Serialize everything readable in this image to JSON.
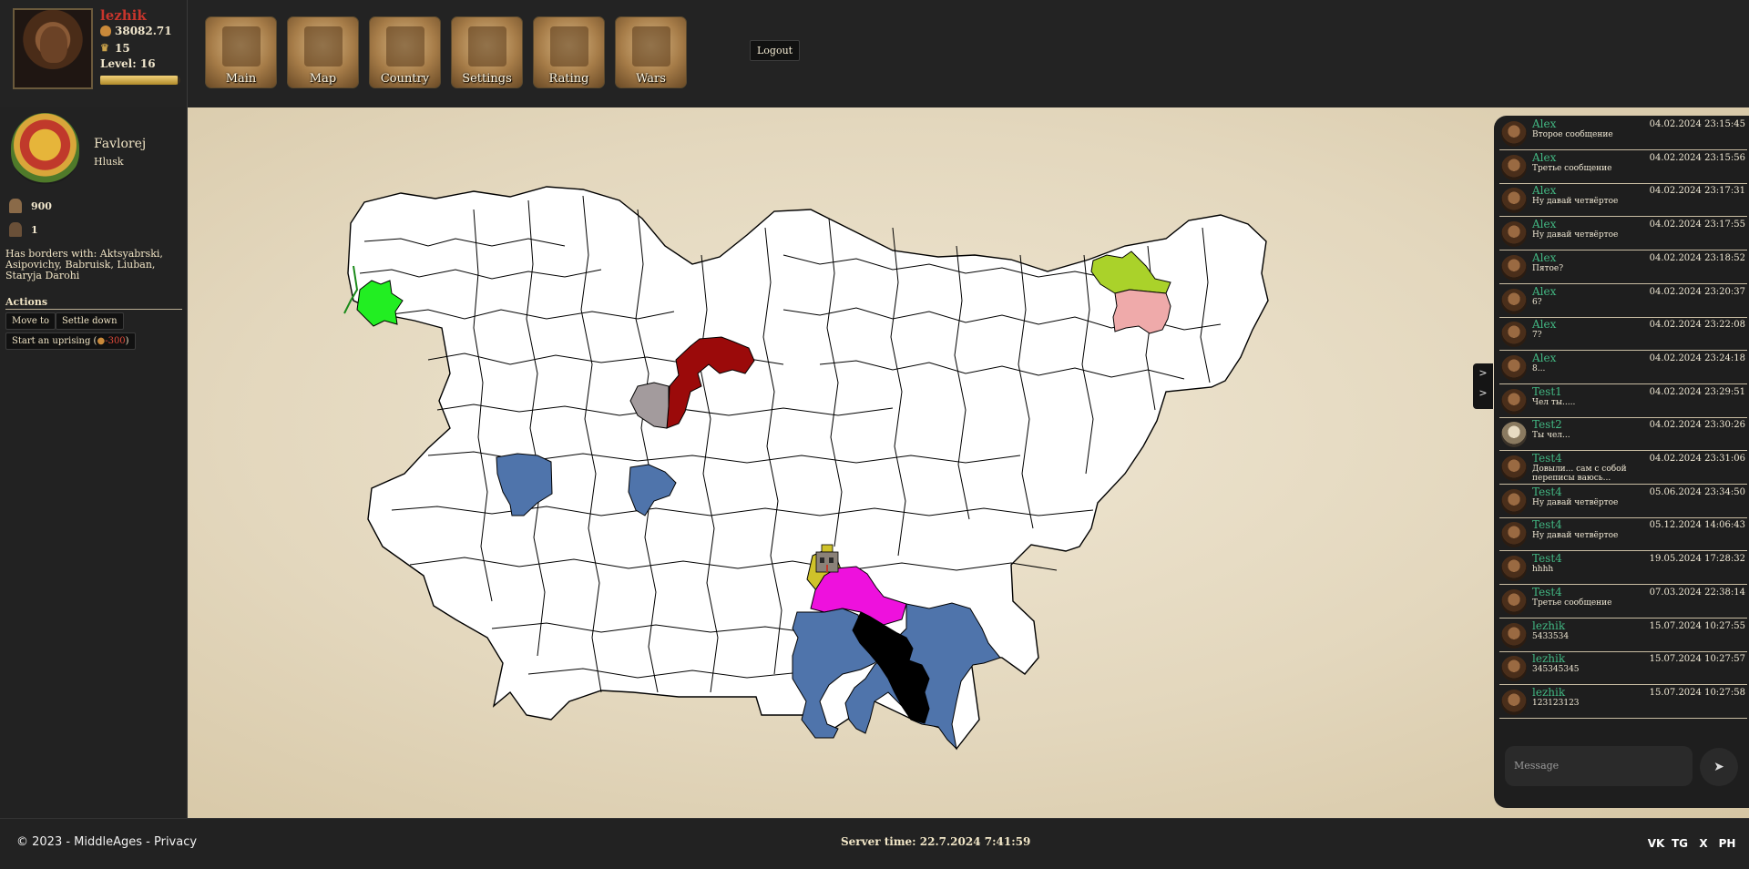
{
  "player": {
    "name": "lezhik",
    "gold": "38082.71",
    "crowns": "15",
    "level": "Level: 16",
    "level_progress": 0.97
  },
  "nav": [
    {
      "label": "Main",
      "icon": "town-icon"
    },
    {
      "label": "Map",
      "icon": "map-icon"
    },
    {
      "label": "Country",
      "icon": "scroll-icon"
    },
    {
      "label": "Settings",
      "icon": "crest-icon"
    },
    {
      "label": "Rating",
      "icon": "knight-icon"
    },
    {
      "label": "Wars",
      "icon": "shield-icon"
    }
  ],
  "logout_label": "Logout",
  "region": {
    "name": "Favlorej",
    "province": "Hlusk",
    "troops": "900",
    "lords": "1",
    "borders_text": "Has borders with: Aktsyabrski, Asipovichy, Babruisk, Liuban, Staryja Darohi",
    "actions_title": "Actions",
    "actions": {
      "move_to": "Move to",
      "settle_down": "Settle down",
      "uprising_label": "Start an uprising (",
      "uprising_cost": "-300",
      "uprising_suffix": ")"
    }
  },
  "map": {
    "colors": {
      "border": "#000000",
      "empty_region": "#ffffff",
      "green": "#22ee22",
      "dark_red": "#9b0a0a",
      "gray": "#a39b9d",
      "steel_blue": "#4f74ab",
      "magenta": "#ee11dd",
      "black": "#000000",
      "yellow": "#cfc22a",
      "lime": "#aad22a",
      "pink": "#efaaaa"
    }
  },
  "chat": {
    "toggle": [
      ">",
      ">"
    ],
    "messages": [
      {
        "user": "Alex",
        "time": "04.02.2024 23:15:45",
        "text": "Второе сообщение"
      },
      {
        "user": "Alex",
        "time": "04.02.2024 23:15:56",
        "text": "Третье сообщение"
      },
      {
        "user": "Alex",
        "time": "04.02.2024 23:17:31",
        "text": "Ну давай четвёртое"
      },
      {
        "user": "Alex",
        "time": "04.02.2024 23:17:55",
        "text": "Ну давай четвёртое"
      },
      {
        "user": "Alex",
        "time": "04.02.2024 23:18:52",
        "text": "Пятое?"
      },
      {
        "user": "Alex",
        "time": "04.02.2024 23:20:37",
        "text": "6?"
      },
      {
        "user": "Alex",
        "time": "04.02.2024 23:22:08",
        "text": "7?"
      },
      {
        "user": "Alex",
        "time": "04.02.2024 23:24:18",
        "text": "8..."
      },
      {
        "user": "Test1",
        "time": "04.02.2024 23:29:51",
        "text": "Чел ты....."
      },
      {
        "user": "Test2",
        "time": "04.02.2024 23:30:26",
        "text": "Ты чел..."
      },
      {
        "user": "Test4",
        "time": "04.02.2024 23:31:06",
        "text": "Довыли... сам с собой переписы ваюсь..."
      },
      {
        "user": "Test4",
        "time": "05.06.2024 23:34:50",
        "text": "Ну давай четвёртое"
      },
      {
        "user": "Test4",
        "time": "05.12.2024 14:06:43",
        "text": "Ну давай четвёртое"
      },
      {
        "user": "Test4",
        "time": "19.05.2024 17:28:32",
        "text": "hhhh"
      },
      {
        "user": "Test4",
        "time": "07.03.2024 22:38:14",
        "text": "Третье сообщение"
      },
      {
        "user": "lezhik",
        "time": "15.07.2024 10:27:55",
        "text": "5433534"
      },
      {
        "user": "lezhik",
        "time": "15.07.2024 10:27:57",
        "text": "345345345"
      },
      {
        "user": "lezhik",
        "time": "15.07.2024 10:27:58",
        "text": "123123123"
      }
    ],
    "placeholder": "Message",
    "send": "➤"
  },
  "footer": {
    "copyright": "© 2023 - MiddleAges - Privacy",
    "server_time": "Server time: 22.7.2024 7:41:59",
    "social": [
      "VK",
      "TG",
      "X",
      "PH"
    ]
  }
}
